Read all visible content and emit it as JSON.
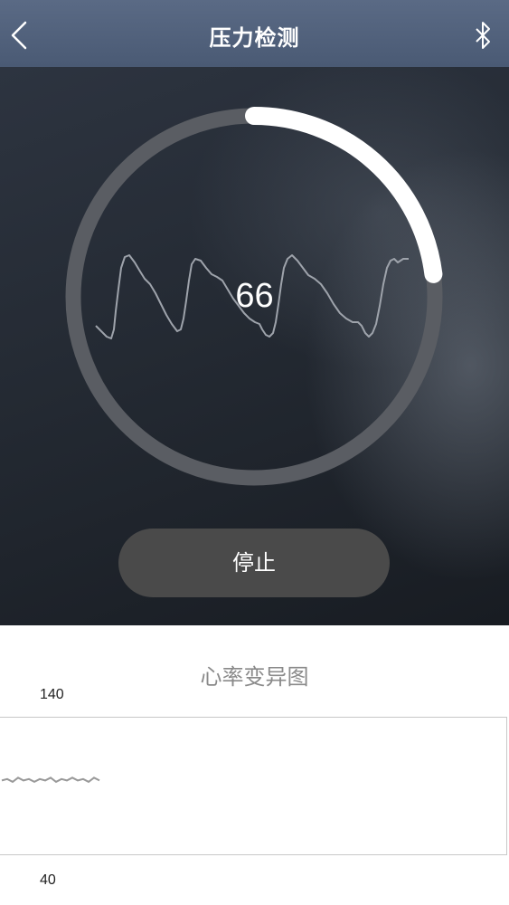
{
  "header": {
    "title": "压力检测",
    "back_icon": "chevron-left-icon",
    "bluetooth_icon": "bluetooth-icon"
  },
  "gauge": {
    "value": "66",
    "progress": 0.23,
    "track_color": "#5a5d63",
    "progress_color": "#ffffff"
  },
  "controls": {
    "stop_label": "停止"
  },
  "chart": {
    "title": "心率变异图"
  },
  "chart_data": {
    "type": "line",
    "title": "心率变异图",
    "ylim": [
      40,
      140
    ],
    "y_tick_labels": [
      "140",
      "40"
    ],
    "series": [
      {
        "values": [
          94,
          95,
          93,
          96,
          94,
          95,
          93,
          95,
          94,
          96,
          93,
          95,
          94,
          96,
          94,
          95,
          93,
          96,
          94
        ]
      }
    ]
  }
}
